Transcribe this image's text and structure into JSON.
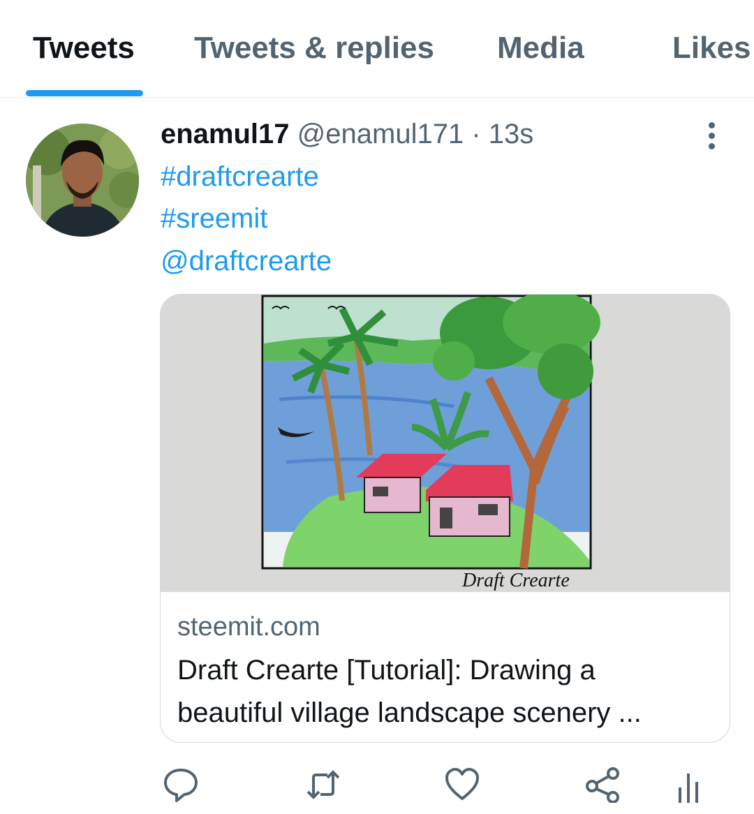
{
  "tabs": [
    {
      "label": "Tweets"
    },
    {
      "label": "Tweets & replies"
    },
    {
      "label": "Media"
    },
    {
      "label": "Likes"
    }
  ],
  "tweet": {
    "author_name": "enamul17",
    "author_handle": "@enamul171",
    "separator": "·",
    "time": "13s",
    "lines": [
      "#draftcrearte",
      "#sreemit",
      "@draftcrearte"
    ],
    "card": {
      "image_signature": "Draft Crearte",
      "domain": "steemit.com",
      "title": "Draft Crearte [Tutorial]: Drawing a beautiful village landscape scenery ..."
    }
  },
  "icons": {
    "more": "more-vertical-icon",
    "reply": "reply-icon",
    "retweet": "retweet-icon",
    "like": "heart-icon",
    "share": "share-icon",
    "analytics": "analytics-icon"
  },
  "colors": {
    "accent": "#1d9bf0",
    "text_primary": "#0f1419",
    "text_secondary": "#536471",
    "border": "#cfd9de"
  }
}
